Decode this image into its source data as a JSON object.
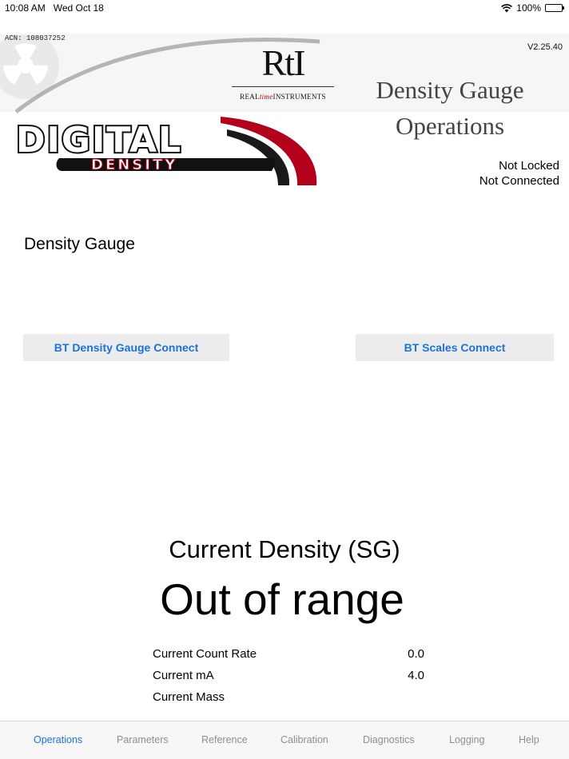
{
  "status_bar": {
    "time": "10:08 AM",
    "date": "Wed Oct 18",
    "battery": "100%",
    "battery_level": 1.0
  },
  "header": {
    "acn": "ACN: 108037252",
    "version": "V2.25.40",
    "logo_rti_mark": "RtI",
    "logo_rti_text_1": "REAL",
    "logo_rti_text_2": "time",
    "logo_rti_text_3": "INSTRUMENTS",
    "logo_digital": "DIGITAL",
    "logo_density": "DENSITY",
    "title_line1": "Density Gauge",
    "title_line2": "Operations",
    "lock_status": "Not Locked",
    "connection_status": "Not Connected"
  },
  "gauge": {
    "section_label": "Density Gauge",
    "connect_gauge_label": "BT Density Gauge Connect",
    "connect_scales_label": "BT Scales Connect"
  },
  "density": {
    "title": "Current Density (SG)",
    "value": "Out of range"
  },
  "metrics": [
    {
      "label": "Current Count Rate",
      "value": "0.0"
    },
    {
      "label": "Current mA",
      "value": "4.0"
    },
    {
      "label": "Current Mass",
      "value": ""
    }
  ],
  "tabs": [
    {
      "label": "Operations",
      "active": true
    },
    {
      "label": "Parameters",
      "active": false
    },
    {
      "label": "Reference",
      "active": false
    },
    {
      "label": "Calibration",
      "active": false
    },
    {
      "label": "Diagnostics",
      "active": false
    },
    {
      "label": "Logging",
      "active": false
    },
    {
      "label": "Help",
      "active": false
    }
  ],
  "colors": {
    "accent": "#1a73d6",
    "logo_red": "#b3001b",
    "inactive_tab": "#8e8e8e"
  }
}
